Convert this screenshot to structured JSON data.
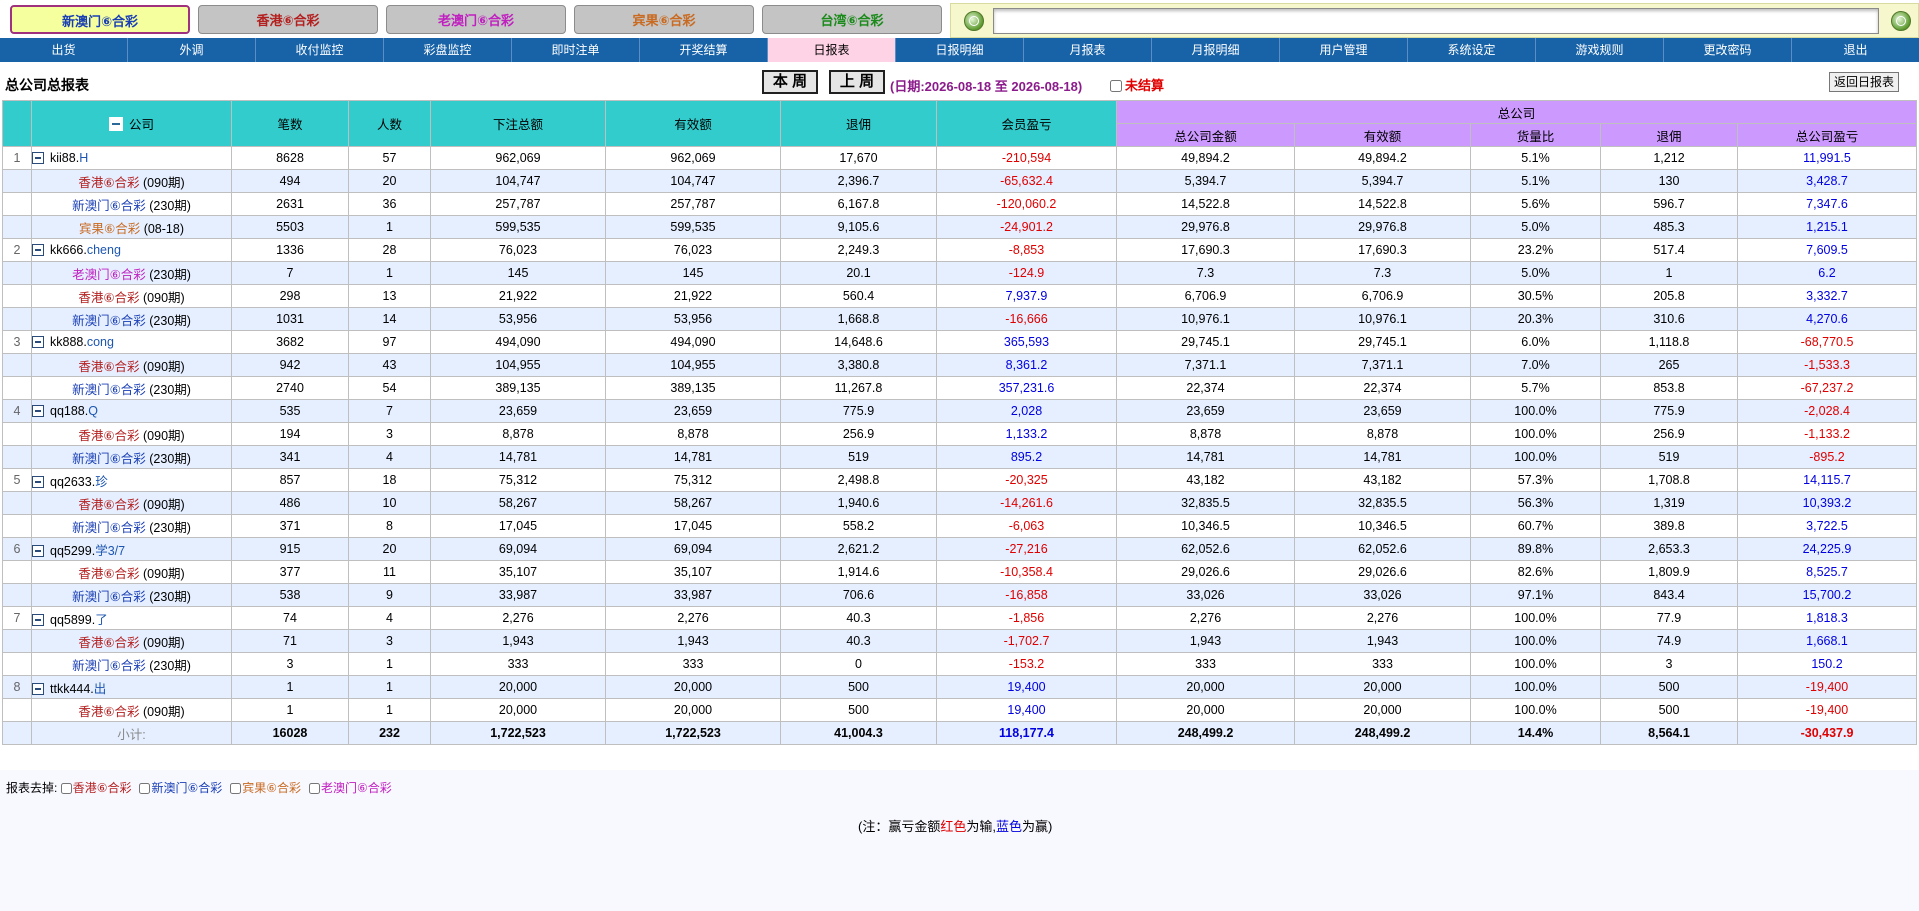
{
  "game_tabs": [
    {
      "label": "新澳门⑥合彩",
      "color": "#1a3fb5",
      "active": true
    },
    {
      "label": "香港⑥合彩",
      "color": "#b42020",
      "active": false
    },
    {
      "label": "老澳门⑥合彩",
      "color": "#c020c0",
      "active": false
    },
    {
      "label": "宾果⑥合彩",
      "color": "#c96a20",
      "active": false
    },
    {
      "label": "台湾⑥合彩",
      "color": "#1a8a1a",
      "active": false
    }
  ],
  "search": {
    "value": "",
    "placeholder": ""
  },
  "nav": [
    "出货",
    "外调",
    "收付监控",
    "彩盘监控",
    "即时注单",
    "开奖结算",
    "日报表",
    "日报明细",
    "月报表",
    "月报明细",
    "用户管理",
    "系统设定",
    "游戏规则",
    "更改密码",
    "退出"
  ],
  "nav_active": "日报表",
  "title": "总公司总报表",
  "this_week": "本 周",
  "last_week": "上 周",
  "date_range": "(日期:2026-08-18 至 2026-08-18)",
  "unsettled": "未结算",
  "back_button": "返回日报表",
  "headers": {
    "company": "公司",
    "bets": "笔数",
    "people": "人数",
    "total_bet": "下注总额",
    "valid": "有效额",
    "rebate": "退佣",
    "member_pl": "会员盈亏",
    "hq_group": "总公司",
    "hq_amount": "总公司金额",
    "hq_valid": "有效额",
    "ratio": "货量比",
    "hq_rebate": "退佣",
    "hq_pl": "总公司盈亏"
  },
  "game_colors": {
    "香港⑥合彩": "#b42020",
    "新澳门⑥合彩": "#1a3fb5",
    "宾果⑥合彩": "#c96a20",
    "老澳门⑥合彩": "#c020c0"
  },
  "rows": [
    {
      "type": "company",
      "idx": "1",
      "account": "kii88.",
      "alias": "H",
      "bets": "8628",
      "people": "57",
      "total": "962,069",
      "valid": "962,069",
      "rebate": "17,670",
      "member_pl": "-210,594",
      "hq_amount": "49,894.2",
      "hq_valid": "49,894.2",
      "ratio": "5.1%",
      "hq_rebate": "1,212",
      "hq_pl": "11,991.5"
    },
    {
      "type": "sub",
      "game": "香港⑥合彩",
      "period": " (090期)",
      "bets": "494",
      "people": "20",
      "total": "104,747",
      "valid": "104,747",
      "rebate": "2,396.7",
      "member_pl": "-65,632.4",
      "hq_amount": "5,394.7",
      "hq_valid": "5,394.7",
      "ratio": "5.1%",
      "hq_rebate": "130",
      "hq_pl": "3,428.7"
    },
    {
      "type": "sub",
      "game": "新澳门⑥合彩",
      "period": " (230期)",
      "bets": "2631",
      "people": "36",
      "total": "257,787",
      "valid": "257,787",
      "rebate": "6,167.8",
      "member_pl": "-120,060.2",
      "hq_amount": "14,522.8",
      "hq_valid": "14,522.8",
      "ratio": "5.6%",
      "hq_rebate": "596.7",
      "hq_pl": "7,347.6"
    },
    {
      "type": "sub",
      "game": "宾果⑥合彩",
      "period": " (08-18)",
      "bets": "5503",
      "people": "1",
      "total": "599,535",
      "valid": "599,535",
      "rebate": "9,105.6",
      "member_pl": "-24,901.2",
      "hq_amount": "29,976.8",
      "hq_valid": "29,976.8",
      "ratio": "5.0%",
      "hq_rebate": "485.3",
      "hq_pl": "1,215.1"
    },
    {
      "type": "company",
      "idx": "2",
      "account": "kk666.",
      "alias": "cheng",
      "bets": "1336",
      "people": "28",
      "total": "76,023",
      "valid": "76,023",
      "rebate": "2,249.3",
      "member_pl": "-8,853",
      "hq_amount": "17,690.3",
      "hq_valid": "17,690.3",
      "ratio": "23.2%",
      "hq_rebate": "517.4",
      "hq_pl": "7,609.5"
    },
    {
      "type": "sub",
      "game": "老澳门⑥合彩",
      "period": " (230期)",
      "bets": "7",
      "people": "1",
      "total": "145",
      "valid": "145",
      "rebate": "20.1",
      "member_pl": "-124.9",
      "hq_amount": "7.3",
      "hq_valid": "7.3",
      "ratio": "5.0%",
      "hq_rebate": "1",
      "hq_pl": "6.2"
    },
    {
      "type": "sub",
      "game": "香港⑥合彩",
      "period": " (090期)",
      "bets": "298",
      "people": "13",
      "total": "21,922",
      "valid": "21,922",
      "rebate": "560.4",
      "member_pl": "7,937.9",
      "hq_amount": "6,706.9",
      "hq_valid": "6,706.9",
      "ratio": "30.5%",
      "hq_rebate": "205.8",
      "hq_pl": "3,332.7"
    },
    {
      "type": "sub",
      "game": "新澳门⑥合彩",
      "period": " (230期)",
      "bets": "1031",
      "people": "14",
      "total": "53,956",
      "valid": "53,956",
      "rebate": "1,668.8",
      "member_pl": "-16,666",
      "hq_amount": "10,976.1",
      "hq_valid": "10,976.1",
      "ratio": "20.3%",
      "hq_rebate": "310.6",
      "hq_pl": "4,270.6"
    },
    {
      "type": "company",
      "idx": "3",
      "account": "kk888.",
      "alias": "cong",
      "bets": "3682",
      "people": "97",
      "total": "494,090",
      "valid": "494,090",
      "rebate": "14,648.6",
      "member_pl": "365,593",
      "hq_amount": "29,745.1",
      "hq_valid": "29,745.1",
      "ratio": "6.0%",
      "hq_rebate": "1,118.8",
      "hq_pl": "-68,770.5"
    },
    {
      "type": "sub",
      "game": "香港⑥合彩",
      "period": " (090期)",
      "bets": "942",
      "people": "43",
      "total": "104,955",
      "valid": "104,955",
      "rebate": "3,380.8",
      "member_pl": "8,361.2",
      "hq_amount": "7,371.1",
      "hq_valid": "7,371.1",
      "ratio": "7.0%",
      "hq_rebate": "265",
      "hq_pl": "-1,533.3"
    },
    {
      "type": "sub",
      "game": "新澳门⑥合彩",
      "period": " (230期)",
      "bets": "2740",
      "people": "54",
      "total": "389,135",
      "valid": "389,135",
      "rebate": "11,267.8",
      "member_pl": "357,231.6",
      "hq_amount": "22,374",
      "hq_valid": "22,374",
      "ratio": "5.7%",
      "hq_rebate": "853.8",
      "hq_pl": "-67,237.2"
    },
    {
      "type": "company",
      "idx": "4",
      "account": "qq188.",
      "alias": "Q",
      "bets": "535",
      "people": "7",
      "total": "23,659",
      "valid": "23,659",
      "rebate": "775.9",
      "member_pl": "2,028",
      "hq_amount": "23,659",
      "hq_valid": "23,659",
      "ratio": "100.0%",
      "hq_rebate": "775.9",
      "hq_pl": "-2,028.4"
    },
    {
      "type": "sub",
      "game": "香港⑥合彩",
      "period": " (090期)",
      "bets": "194",
      "people": "3",
      "total": "8,878",
      "valid": "8,878",
      "rebate": "256.9",
      "member_pl": "1,133.2",
      "hq_amount": "8,878",
      "hq_valid": "8,878",
      "ratio": "100.0%",
      "hq_rebate": "256.9",
      "hq_pl": "-1,133.2"
    },
    {
      "type": "sub",
      "game": "新澳门⑥合彩",
      "period": " (230期)",
      "bets": "341",
      "people": "4",
      "total": "14,781",
      "valid": "14,781",
      "rebate": "519",
      "member_pl": "895.2",
      "hq_amount": "14,781",
      "hq_valid": "14,781",
      "ratio": "100.0%",
      "hq_rebate": "519",
      "hq_pl": "-895.2"
    },
    {
      "type": "company",
      "idx": "5",
      "account": "qq2633.",
      "alias": "珍",
      "bets": "857",
      "people": "18",
      "total": "75,312",
      "valid": "75,312",
      "rebate": "2,498.8",
      "member_pl": "-20,325",
      "hq_amount": "43,182",
      "hq_valid": "43,182",
      "ratio": "57.3%",
      "hq_rebate": "1,708.8",
      "hq_pl": "14,115.7"
    },
    {
      "type": "sub",
      "game": "香港⑥合彩",
      "period": " (090期)",
      "bets": "486",
      "people": "10",
      "total": "58,267",
      "valid": "58,267",
      "rebate": "1,940.6",
      "member_pl": "-14,261.6",
      "hq_amount": "32,835.5",
      "hq_valid": "32,835.5",
      "ratio": "56.3%",
      "hq_rebate": "1,319",
      "hq_pl": "10,393.2"
    },
    {
      "type": "sub",
      "game": "新澳门⑥合彩",
      "period": " (230期)",
      "bets": "371",
      "people": "8",
      "total": "17,045",
      "valid": "17,045",
      "rebate": "558.2",
      "member_pl": "-6,063",
      "hq_amount": "10,346.5",
      "hq_valid": "10,346.5",
      "ratio": "60.7%",
      "hq_rebate": "389.8",
      "hq_pl": "3,722.5"
    },
    {
      "type": "company",
      "idx": "6",
      "account": "qq5299.",
      "alias": "学3/7",
      "bets": "915",
      "people": "20",
      "total": "69,094",
      "valid": "69,094",
      "rebate": "2,621.2",
      "member_pl": "-27,216",
      "hq_amount": "62,052.6",
      "hq_valid": "62,052.6",
      "ratio": "89.8%",
      "hq_rebate": "2,653.3",
      "hq_pl": "24,225.9"
    },
    {
      "type": "sub",
      "game": "香港⑥合彩",
      "period": " (090期)",
      "bets": "377",
      "people": "11",
      "total": "35,107",
      "valid": "35,107",
      "rebate": "1,914.6",
      "member_pl": "-10,358.4",
      "hq_amount": "29,026.6",
      "hq_valid": "29,026.6",
      "ratio": "82.6%",
      "hq_rebate": "1,809.9",
      "hq_pl": "8,525.7"
    },
    {
      "type": "sub",
      "game": "新澳门⑥合彩",
      "period": " (230期)",
      "bets": "538",
      "people": "9",
      "total": "33,987",
      "valid": "33,987",
      "rebate": "706.6",
      "member_pl": "-16,858",
      "hq_amount": "33,026",
      "hq_valid": "33,026",
      "ratio": "97.1%",
      "hq_rebate": "843.4",
      "hq_pl": "15,700.2"
    },
    {
      "type": "company",
      "idx": "7",
      "account": "qq5899.",
      "alias": "了",
      "bets": "74",
      "people": "4",
      "total": "2,276",
      "valid": "2,276",
      "rebate": "40.3",
      "member_pl": "-1,856",
      "hq_amount": "2,276",
      "hq_valid": "2,276",
      "ratio": "100.0%",
      "hq_rebate": "77.9",
      "hq_pl": "1,818.3"
    },
    {
      "type": "sub",
      "game": "香港⑥合彩",
      "period": " (090期)",
      "bets": "71",
      "people": "3",
      "total": "1,943",
      "valid": "1,943",
      "rebate": "40.3",
      "member_pl": "-1,702.7",
      "hq_amount": "1,943",
      "hq_valid": "1,943",
      "ratio": "100.0%",
      "hq_rebate": "74.9",
      "hq_pl": "1,668.1"
    },
    {
      "type": "sub",
      "game": "新澳门⑥合彩",
      "period": " (230期)",
      "bets": "3",
      "people": "1",
      "total": "333",
      "valid": "333",
      "rebate": "0",
      "member_pl": "-153.2",
      "hq_amount": "333",
      "hq_valid": "333",
      "ratio": "100.0%",
      "hq_rebate": "3",
      "hq_pl": "150.2"
    },
    {
      "type": "company",
      "idx": "8",
      "account": "ttkk444.",
      "alias": "出",
      "bets": "1",
      "people": "1",
      "total": "20,000",
      "valid": "20,000",
      "rebate": "500",
      "member_pl": "19,400",
      "hq_amount": "20,000",
      "hq_valid": "20,000",
      "ratio": "100.0%",
      "hq_rebate": "500",
      "hq_pl": "-19,400"
    },
    {
      "type": "sub",
      "game": "香港⑥合彩",
      "period": " (090期)",
      "bets": "1",
      "people": "1",
      "total": "20,000",
      "valid": "20,000",
      "rebate": "500",
      "member_pl": "19,400",
      "hq_amount": "20,000",
      "hq_valid": "20,000",
      "ratio": "100.0%",
      "hq_rebate": "500",
      "hq_pl": "-19,400"
    }
  ],
  "total": {
    "label": "小计:",
    "bets": "16028",
    "people": "232",
    "total": "1,722,523",
    "valid": "1,722,523",
    "rebate": "41,004.3",
    "member_pl": "118,177.4",
    "hq_amount": "248,499.2",
    "hq_valid": "248,499.2",
    "ratio": "14.4%",
    "hq_rebate": "8,564.1",
    "hq_pl": "-30,437.9"
  },
  "filters_label": "报表去掉:",
  "filters": [
    "香港⑥合彩",
    "新澳门⑥合彩",
    "宾果⑥合彩",
    "老澳门⑥合彩"
  ],
  "note": {
    "prefix": "(注：赢亏金额",
    "red": "红色",
    "mid": "为输,",
    "blue": "蓝色",
    "suffix": "为赢)"
  }
}
